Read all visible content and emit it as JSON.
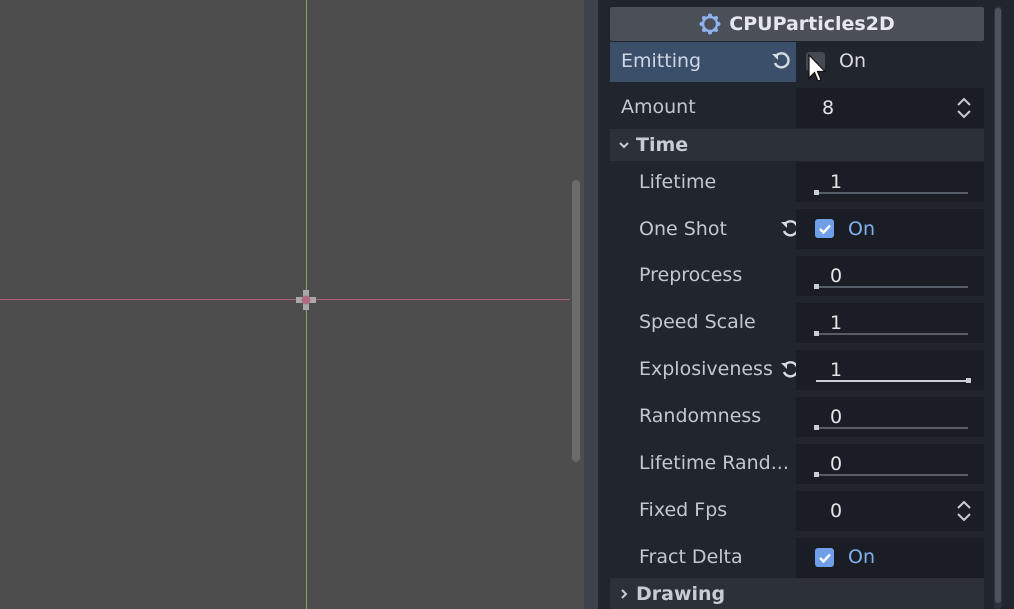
{
  "inspector": {
    "header_title": "CPUParticles2D",
    "emitting": {
      "label": "Emitting",
      "state": "On",
      "checked": false
    },
    "amount": {
      "label": "Amount",
      "value": "8"
    },
    "time_section": "Time",
    "lifetime": {
      "label": "Lifetime",
      "value": "1",
      "slider_fraction": 0.0
    },
    "one_shot": {
      "label": "One Shot",
      "state": "On",
      "checked": true
    },
    "preprocess": {
      "label": "Preprocess",
      "value": "0",
      "slider_fraction": 0.0
    },
    "speed_scale": {
      "label": "Speed Scale",
      "value": "1",
      "slider_fraction": 0.0
    },
    "explosiveness": {
      "label": "Explosiveness",
      "value": "1",
      "slider_fraction": 1.0
    },
    "randomness": {
      "label": "Randomness",
      "value": "0",
      "slider_fraction": 0.0
    },
    "lifetime_randomness": {
      "label": "Lifetime Rand...",
      "value": "0",
      "slider_fraction": 0.0
    },
    "fixed_fps": {
      "label": "Fixed Fps",
      "value": "0"
    },
    "fract_delta": {
      "label": "Fract Delta",
      "state": "On",
      "checked": true
    },
    "drawing_section": "Drawing"
  },
  "colors": {
    "accent": "#6e9fe8",
    "selected_row": "#3b4f6a",
    "panel_bg": "#21252d"
  },
  "icons": [
    "cpu-particles-icon",
    "revert-icon",
    "checkbox-icon",
    "spinner-arrows-icon",
    "chevron-down-icon",
    "chevron-right-icon",
    "mouse-cursor-icon"
  ]
}
